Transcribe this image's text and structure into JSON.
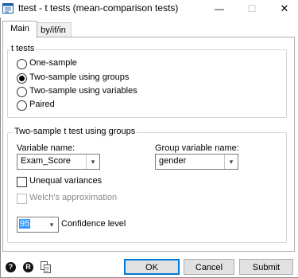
{
  "window": {
    "title": "ttest - t tests (mean-comparison tests)",
    "minimize_glyph": "—",
    "maximize_glyph": "☐",
    "close_glyph": "✕"
  },
  "tabs": [
    {
      "label": "Main",
      "active": true
    },
    {
      "label": "by/if/in",
      "active": false
    }
  ],
  "ttests": {
    "legend": "t tests",
    "options": [
      {
        "label": "One-sample",
        "selected": false
      },
      {
        "label": "Two-sample using groups",
        "selected": true
      },
      {
        "label": "Two-sample using variables",
        "selected": false
      },
      {
        "label": "Paired",
        "selected": false
      }
    ]
  },
  "groups_box": {
    "legend": "Two-sample t test using groups",
    "variable_label": "Variable name:",
    "variable_value": "Exam_Score",
    "group_label": "Group variable name:",
    "group_value": "gender",
    "unequal_label": "Unequal variances",
    "unequal_checked": false,
    "welch_label": "Welch's approximation",
    "welch_checked": false,
    "welch_enabled": false,
    "confidence_value": "95",
    "confidence_label": "Confidence level"
  },
  "footer": {
    "help_glyph": "?",
    "reset_glyph": "R",
    "ok_label": "OK",
    "cancel_label": "Cancel",
    "submit_label": "Submit"
  },
  "colors": {
    "accent": "#0078d7",
    "selection": "#3399ff"
  }
}
